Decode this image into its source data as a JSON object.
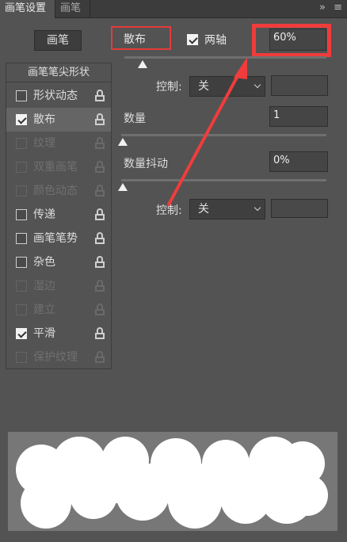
{
  "tabs": {
    "active": "画笔设置",
    "inactive": "画笔"
  },
  "tab_icons": {
    "expand": "»",
    "menu": "≡"
  },
  "brush_button": "画笔",
  "list": {
    "header": "画笔笔尖形状",
    "items": [
      {
        "label": "形状动态",
        "checked": false,
        "enabled": true,
        "selected": false
      },
      {
        "label": "散布",
        "checked": true,
        "enabled": true,
        "selected": true
      },
      {
        "label": "纹理",
        "checked": false,
        "enabled": false,
        "selected": false
      },
      {
        "label": "双重画笔",
        "checked": false,
        "enabled": false,
        "selected": false
      },
      {
        "label": "颜色动态",
        "checked": false,
        "enabled": false,
        "selected": false
      },
      {
        "label": "传递",
        "checked": false,
        "enabled": true,
        "selected": false
      },
      {
        "label": "画笔笔势",
        "checked": false,
        "enabled": true,
        "selected": false
      },
      {
        "label": "杂色",
        "checked": false,
        "enabled": true,
        "selected": false
      },
      {
        "label": "湿边",
        "checked": false,
        "enabled": false,
        "selected": false
      },
      {
        "label": "建立",
        "checked": false,
        "enabled": false,
        "selected": false
      },
      {
        "label": "平滑",
        "checked": true,
        "enabled": true,
        "selected": false
      },
      {
        "label": "保护纹理",
        "checked": false,
        "enabled": false,
        "selected": false
      }
    ]
  },
  "scatter": {
    "label": "散布",
    "both_axes_label": "两轴",
    "both_axes_checked": true,
    "value": "60%",
    "slider_level": 0.06,
    "control_label": "控制:",
    "control_value": "关"
  },
  "count": {
    "label": "数量",
    "value": "1",
    "slider_level": 0.0
  },
  "count_jitter": {
    "label": "数量抖动",
    "value": "0%",
    "slider_level": 0.0,
    "control_label": "控制:",
    "control_value": "关"
  },
  "colors": {
    "highlight": "#f03c3c",
    "panel": "#535353",
    "preview_bg": "#777777"
  }
}
